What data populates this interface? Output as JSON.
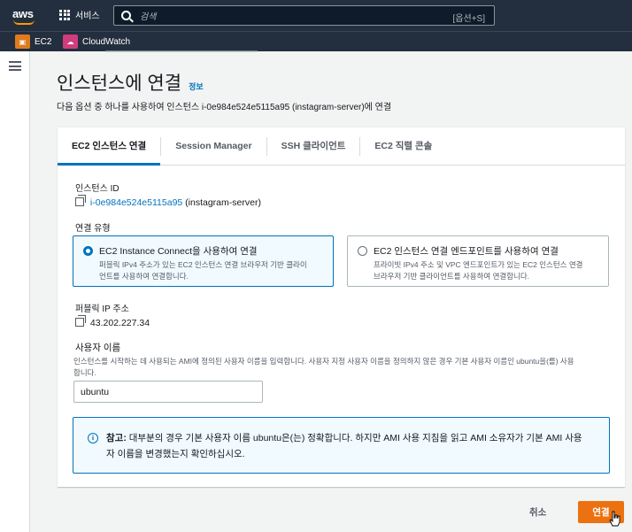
{
  "topnav": {
    "logo_text": "aws",
    "services_label": "서비스",
    "search_placeholder": "검색",
    "search_shortcut": "[옵션+S]"
  },
  "servicebar": {
    "favorites": [
      {
        "label": "EC2",
        "icon": "ec2-icon",
        "color": "#e07b1d"
      },
      {
        "label": "CloudWatch",
        "icon": "cloudwatch-icon",
        "color": "#d13c7d"
      }
    ]
  },
  "page": {
    "title": "인스턴스에 연결",
    "info_link": "정보",
    "description": "다음 옵션 중 하나를 사용하여 인스턴스 i-0e984e524e5115a95 (instagram-server)에 연결"
  },
  "tabs": [
    {
      "label": "EC2 인스턴스 연결",
      "active": true
    },
    {
      "label": "Session Manager",
      "active": false
    },
    {
      "label": "SSH 클라이언트",
      "active": false
    },
    {
      "label": "EC2 직렬 콘솔",
      "active": false
    }
  ],
  "form": {
    "instance_id_label": "인스턴스 ID",
    "instance_id": "i-0e984e524e5115a95",
    "instance_name": "(instagram-server)",
    "connection_type_label": "연결 유형",
    "options": [
      {
        "title": "EC2 Instance Connect을 사용하여 연결",
        "desc_line1": "퍼블릭 IPv4 주소가 있는 EC2 인스턴스 연결 브라우저 기반 클라이",
        "desc_line2": "언트를 사용하여 연결합니다.",
        "selected": true
      },
      {
        "title": "EC2 인스턴스 연결 엔드포인트를 사용하여 연결",
        "desc_line1": "프라이빗 IPv4 주소 및 VPC 엔드포인트가 있는 EC2 인스턴스 연결",
        "desc_line2": "브라우저 기반 클라이언트를 사용하여 연결합니다.",
        "selected": false
      }
    ],
    "public_ip_label": "퍼블릭 IP 주소",
    "public_ip": "43.202.227.34",
    "username_label": "사용자 이름",
    "username_desc": "인스턴스를 시작하는 데 사용되는 AMI에 정의된 사용자 이름을 입력합니다. 사용자 지정 사용자 이름을 정의하지 않은 경우 기본 사용자 이름인 ubuntu을(를) 사용",
    "username_desc2": "합니다.",
    "username_value": "ubuntu"
  },
  "alert": {
    "prefix": "참고:",
    "line1": " 대부분의 경우 기본 사용자 이름 ubuntu은(는) 정확합니다. 하지만 AMI 사용 지침을 읽고 AMI 소유자가 기본 AMI 사용",
    "line2": "자 이름을 변경했는지 확인하십시오."
  },
  "actions": {
    "cancel": "취소",
    "connect": "연결"
  },
  "colors": {
    "nav_bg": "#232f3e",
    "accent_orange": "#ec7211",
    "link_blue": "#0073bb"
  }
}
